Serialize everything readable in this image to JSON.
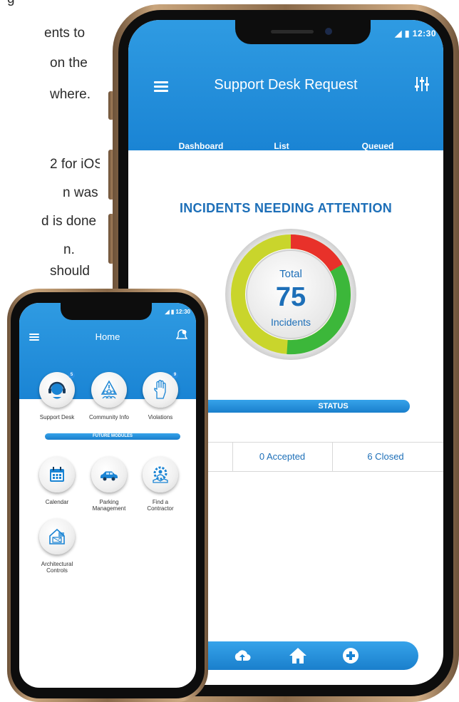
{
  "background_text": [
    {
      "text": "g",
      "note": ""
    },
    {
      "text": "ents to"
    },
    {
      "text": "on the"
    },
    {
      "text": "where."
    },
    {
      "text": "2 for iOS."
    },
    {
      "text": "n was"
    },
    {
      "text": "d is done"
    },
    {
      "text": "n."
    },
    {
      "text": "should"
    }
  ],
  "big_phone": {
    "status_time": "12:30",
    "title": "Support Desk Request",
    "tabs": [
      "Dashboard",
      "List",
      "Queued"
    ],
    "active_tab": "Dashboard",
    "section_title": "INCIDENTS NEEDING ATTENTION",
    "donut": {
      "total_label": "Total",
      "total_value": "75",
      "unit_label": "Incidents",
      "colors": {
        "red": "#e8312a",
        "green": "#3cb73a",
        "yellowgreen": "#c9d52c"
      }
    },
    "status_label": "STATUS",
    "counts": [
      "0 Accepted",
      "6 Closed"
    ],
    "bottom_nav_icons": [
      "cloud-upload-icon",
      "home-icon",
      "plus-circle-icon"
    ]
  },
  "small_phone": {
    "status_time": "12:30",
    "title": "Home",
    "modules": [
      {
        "label": "Support Desk",
        "badge": "5"
      },
      {
        "label": "Community Info",
        "badge": ""
      },
      {
        "label": "Violations",
        "badge": "9"
      }
    ],
    "future_label": "FUTURE MODULES",
    "future_modules": [
      {
        "label": "Calendar"
      },
      {
        "label": "Parking\nManagement"
      },
      {
        "label": "Find a\nContractor"
      },
      {
        "label": "Architectural\nControls"
      }
    ]
  },
  "colors": {
    "accent": "#1a84d4",
    "title_blue": "#1d6fb8"
  }
}
